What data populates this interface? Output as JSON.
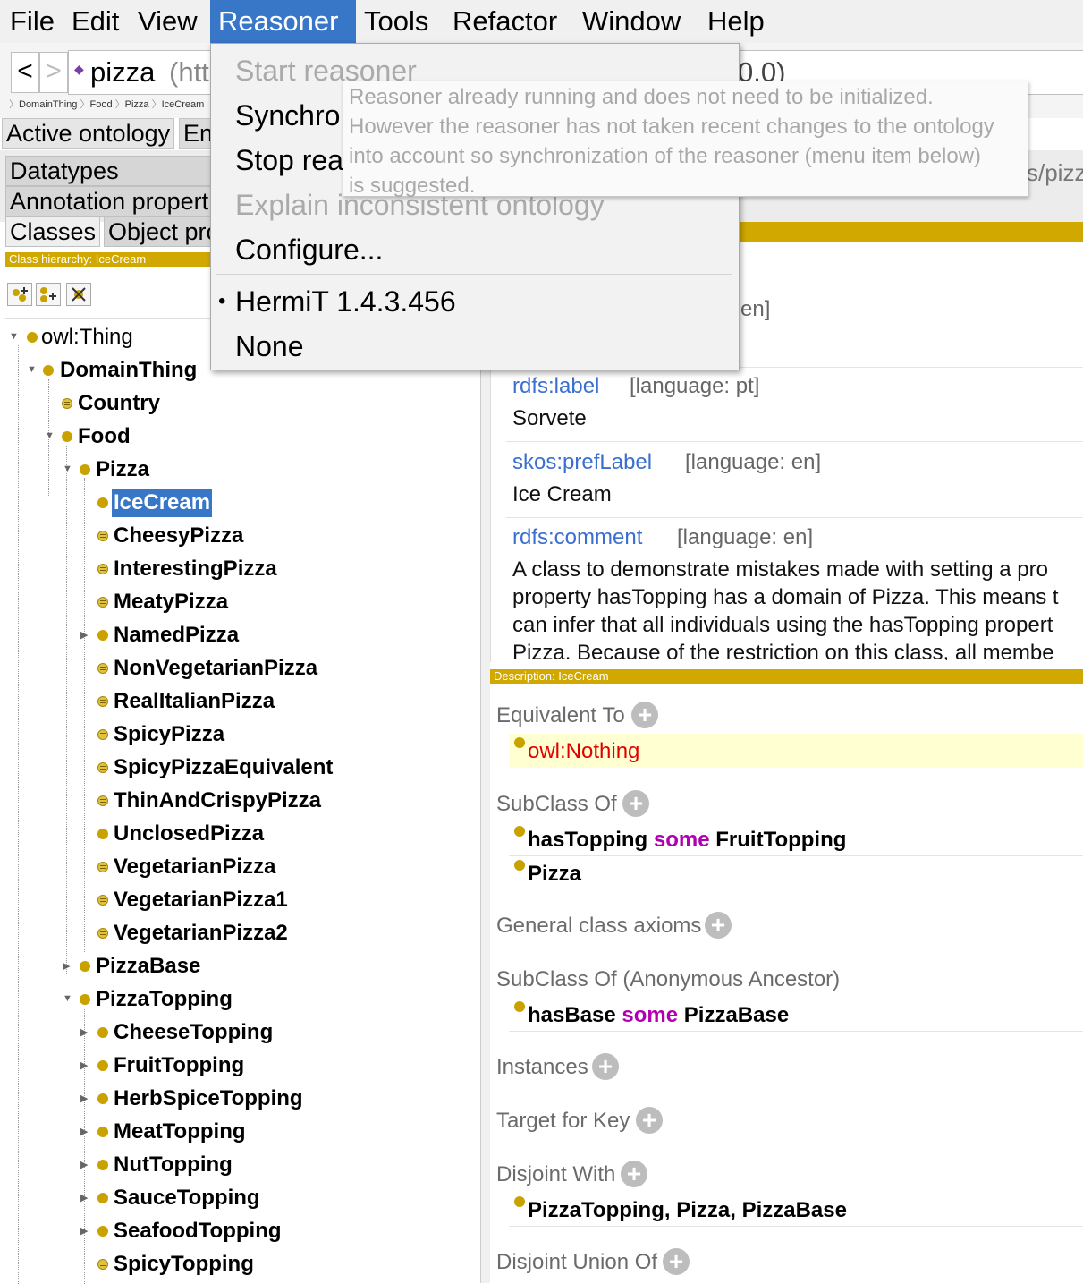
{
  "menubar": {
    "items": [
      "File",
      "Edit",
      "View",
      "Reasoner",
      "Tools",
      "Refactor",
      "Window",
      "Help"
    ],
    "active": "Reasoner"
  },
  "toolbar": {
    "back": "<",
    "forward": ">",
    "ontology_name": "pizza",
    "ontology_iri_fragment": "(htt",
    "version_fragment": "0.0)",
    "right_iri_fragment": "s/pizz"
  },
  "breadcrumb": [
    "DomainThing",
    "Food",
    "Pizza",
    "IceCream"
  ],
  "tabs": {
    "active_ontology": "Active ontology",
    "entities_fragment": "En"
  },
  "entity_tabs": {
    "datatypes": "Datatypes",
    "annotation_properties": "Annotation propert",
    "classes": "Classes",
    "object_properties": "Object pro"
  },
  "hierarchy": {
    "header": "Class hierarchy: IceCream",
    "tree": [
      {
        "label": "owl:Thing"
      },
      {
        "label": "DomainThing"
      },
      {
        "label": "Country"
      },
      {
        "label": "Food"
      },
      {
        "label": "Pizza"
      },
      {
        "label": "IceCream"
      },
      {
        "label": "CheesyPizza"
      },
      {
        "label": "InterestingPizza"
      },
      {
        "label": "MeatyPizza"
      },
      {
        "label": "NamedPizza"
      },
      {
        "label": "NonVegetarianPizza"
      },
      {
        "label": "RealItalianPizza"
      },
      {
        "label": "SpicyPizza"
      },
      {
        "label": "SpicyPizzaEquivalent"
      },
      {
        "label": "ThinAndCrispyPizza"
      },
      {
        "label": "UnclosedPizza"
      },
      {
        "label": "VegetarianPizza"
      },
      {
        "label": "VegetarianPizza1"
      },
      {
        "label": "VegetarianPizza2"
      },
      {
        "label": "PizzaBase"
      },
      {
        "label": "PizzaTopping"
      },
      {
        "label": "CheeseTopping"
      },
      {
        "label": "FruitTopping"
      },
      {
        "label": "HerbSpiceTopping"
      },
      {
        "label": "MeatTopping"
      },
      {
        "label": "NutTopping"
      },
      {
        "label": "SauceTopping"
      },
      {
        "label": "SeafoodTopping"
      },
      {
        "label": "SpicyTopping"
      }
    ]
  },
  "annotations": {
    "partial_lang": "en]",
    "items": [
      {
        "property": "rdfs:label",
        "lang": "[language: pt]",
        "value": "Sorvete"
      },
      {
        "property": "skos:prefLabel",
        "lang": "[language: en]",
        "value": "Ice Cream"
      },
      {
        "property": "rdfs:comment",
        "lang": "[language: en]",
        "value_lines": [
          "A class to demonstrate mistakes made with setting a pro",
          "property hasTopping has a domain of Pizza. This means t",
          "can infer that all individuals using the hasTopping propert",
          "Pizza. Because of the restriction on this class, all membe"
        ]
      }
    ]
  },
  "description": {
    "header": "Description: IceCream",
    "sections": {
      "equivalent_to": {
        "title": "Equivalent To",
        "items": [
          "owl:Nothing"
        ]
      },
      "subclass_of": {
        "title": "SubClass Of",
        "items": [
          {
            "prop": "hasTopping",
            "kw": "some",
            "filler": "FruitTopping"
          },
          {
            "prop": "Pizza",
            "kw": "",
            "filler": ""
          }
        ]
      },
      "general_axioms": {
        "title": "General class axioms"
      },
      "anon_ancestor": {
        "title": "SubClass Of (Anonymous Ancestor)",
        "items": [
          {
            "prop": "hasBase",
            "kw": "some",
            "filler": "PizzaBase"
          }
        ]
      },
      "instances": {
        "title": "Instances"
      },
      "target_for_key": {
        "title": "Target for Key"
      },
      "disjoint_with": {
        "title": "Disjoint With",
        "items": [
          "PizzaTopping, Pizza, PizzaBase"
        ]
      },
      "disjoint_union": {
        "title": "Disjoint Union Of"
      }
    }
  },
  "reasoner_menu": {
    "items": [
      {
        "label": "Start reasoner",
        "enabled": false
      },
      {
        "label": "Synchro",
        "enabled": true
      },
      {
        "label": "Stop rea",
        "enabled": true
      },
      {
        "label": "Explain inconsistent ontology",
        "enabled": false
      },
      {
        "label": "Configure...",
        "enabled": true
      },
      {
        "label": "HermiT 1.4.3.456",
        "enabled": true,
        "selected": true
      },
      {
        "label": "None",
        "enabled": true
      }
    ],
    "tooltip_lines": [
      "Reasoner already running and does not need to be initialized.",
      "However the reasoner has not taken recent changes to the ontology",
      "into account so synchronization of the reasoner (menu item below)",
      "is suggested."
    ]
  },
  "colors": {
    "accent": "#3876c8",
    "gold": "#d1a800",
    "annotation_link": "#3a6fcf",
    "keyword": "#b000b0",
    "inconsistent": "#e00000"
  }
}
